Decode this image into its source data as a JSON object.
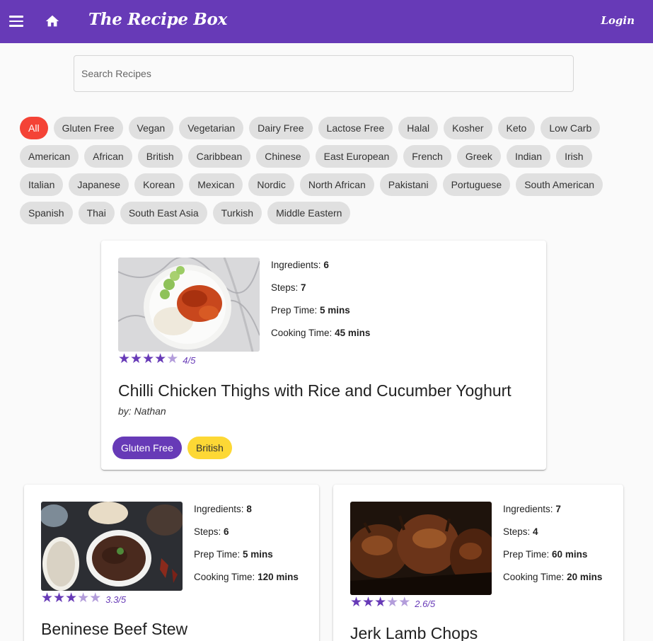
{
  "header": {
    "menu_icon": "menu-icon",
    "home_icon": "home-icon",
    "title": "The Recipe Box",
    "login_label": "Login",
    "color": "#673ab7"
  },
  "search": {
    "placeholder": "Search Recipes",
    "value": ""
  },
  "filters": [
    "All",
    "Gluten Free",
    "Vegan",
    "Vegetarian",
    "Dairy Free",
    "Lactose Free",
    "Halal",
    "Kosher",
    "Keto",
    "Low Carb",
    "American",
    "African",
    "British",
    "Caribbean",
    "Chinese",
    "East European",
    "French",
    "Greek",
    "Indian",
    "Irish",
    "Italian",
    "Japanese",
    "Korean",
    "Mexican",
    "Nordic",
    "North African",
    "Pakistani",
    "Portuguese",
    "South American",
    "Spanish",
    "Thai",
    "South East Asia",
    "Turkish",
    "Middle Eastern"
  ],
  "active_filter": "All",
  "recipes": [
    {
      "title": "Chilli Chicken Thighs with Rice and Cucumber Yoghurt",
      "author": "by: Nathan",
      "ingredients_label": "Ingredients:",
      "ingredients": "6",
      "steps_label": "Steps:",
      "steps": "7",
      "prep_label": "Prep Time:",
      "prep": "5 mins",
      "cook_label": "Cooking Time:",
      "cook": "45 mins",
      "rating": 4,
      "rating_text": "4/5",
      "tags": [
        {
          "label": "Gluten Free",
          "bg": "#673ab7",
          "fg": "#ffffff"
        },
        {
          "label": "British",
          "bg": "#fdd835",
          "fg": "#333333"
        }
      ]
    },
    {
      "title": "Beninese Beef Stew",
      "author": "",
      "ingredients_label": "Ingredients:",
      "ingredients": "8",
      "steps_label": "Steps:",
      "steps": "6",
      "prep_label": "Prep Time:",
      "prep": "5 mins",
      "cook_label": "Cooking Time:",
      "cook": "120 mins",
      "rating": 3.3,
      "rating_text": "3.3/5",
      "tags": []
    },
    {
      "title": "Jerk Lamb Chops",
      "author": "",
      "ingredients_label": "Ingredients:",
      "ingredients": "7",
      "steps_label": "Steps:",
      "steps": "4",
      "prep_label": "Prep Time:",
      "prep": "60 mins",
      "cook_label": "Cooking Time:",
      "cook": "20 mins",
      "rating": 2.6,
      "rating_text": "2.6/5",
      "tags": []
    }
  ],
  "colors": {
    "accent": "#673ab7",
    "star_empty": "#b39ddb",
    "chip_active": "#f44336",
    "chip": "#e0e0e0"
  }
}
